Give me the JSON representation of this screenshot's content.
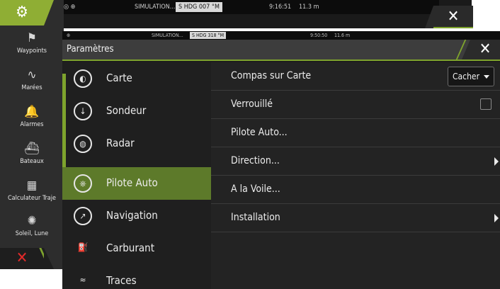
{
  "back_window": {
    "status": {
      "icons": "◎ ⊕",
      "sim": "SIMULATION...",
      "heading": "S HDG 007 °M",
      "time": "9:16:51",
      "distance": "11.3 m"
    },
    "close_label": "✕"
  },
  "left_panel": {
    "gear_icon": "⚙",
    "items": [
      {
        "icon": "⚑",
        "label": "Waypoints"
      },
      {
        "icon": "∿",
        "label": "Marées"
      },
      {
        "icon": "🔔",
        "label": "Alarmes"
      },
      {
        "icon": "⛴",
        "label": "Bateaux"
      },
      {
        "icon": "▦",
        "label": "Calculateur Traje"
      },
      {
        "icon": "✺",
        "label": "Soleil, Lune"
      }
    ],
    "close_icon": "✕"
  },
  "front_window": {
    "status": {
      "icon": "⊕",
      "sim": "SIMULATION...",
      "heading": "S HDG 318 °M",
      "time": "9:50:50",
      "distance": "11.6 m"
    },
    "title": "Paramètres",
    "close_label": "✕"
  },
  "menu": {
    "items": [
      {
        "icon": "◐",
        "label": "Carte"
      },
      {
        "icon": "↓",
        "label": "Sondeur"
      },
      {
        "icon": "◍",
        "label": "Radar"
      },
      {
        "icon": "⎈",
        "label": "Pilote Auto"
      },
      {
        "icon": "↗",
        "label": "Navigation"
      },
      {
        "icon": "⛽",
        "label": "Carburant"
      },
      {
        "icon": "≈",
        "label": "Traces"
      }
    ],
    "active_index": 3
  },
  "settings": {
    "rows": [
      {
        "label": "Compas sur Carte"
      },
      {
        "label": "Verrouillé"
      },
      {
        "label": "Pilote Auto..."
      },
      {
        "label": "Direction..."
      },
      {
        "label": "A la Voile..."
      },
      {
        "label": "Installation"
      }
    ],
    "compass_value": "Cacher"
  },
  "colors": {
    "accent": "#7ea32d",
    "active": "#5d7a2a",
    "close_red": "#e02a2a"
  }
}
